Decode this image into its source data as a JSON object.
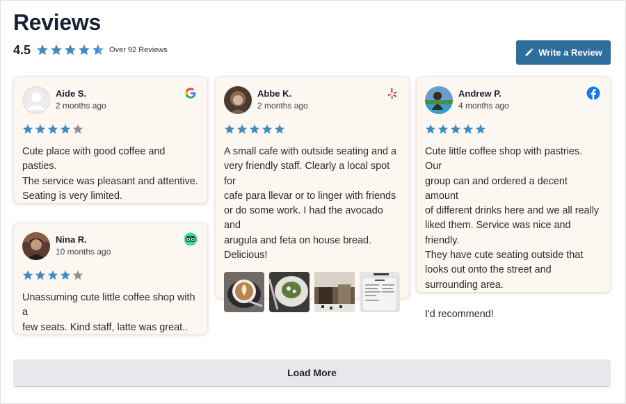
{
  "header": {
    "title": "Reviews",
    "average": "4.5",
    "rating_value": 4.5,
    "count_text": "Over 92 Reviews",
    "write_review_label": "Write a Review"
  },
  "colors": {
    "star_filled": "#3f8bc4",
    "star_empty": "#8f8f8f",
    "button": "#2f6d9d",
    "card_bg": "#fdf7f2"
  },
  "reviews": [
    {
      "name": "Aide S.",
      "time": "2 months ago",
      "source": "google-icon",
      "rating": 4,
      "text": "Cute place with good coffee and pasties.\nThe service was pleasant and attentive.\nSeating is very limited."
    },
    {
      "name": "Nina R.",
      "time": "10 months ago",
      "source": "tripadvisor-icon",
      "rating": 4,
      "text": "Unassuming cute little coffee shop with a\nfew seats. Kind staff, latte was great.."
    },
    {
      "name": "Abbe K.",
      "time": "2 months ago",
      "source": "yelp-icon",
      "rating": 5,
      "text": "A small cafe with outside seating and a\nvery friendly staff. Clearly a local spot for\ncafe para llevar or to linger with friends\nor do some work. I had the avocado and\narugula and feta on house bread.\nDelicious!",
      "photos": [
        "latte-art-photo",
        "salad-plate-photo",
        "cafe-interior-photo",
        "menu-board-photo"
      ]
    },
    {
      "name": "Andrew P.",
      "time": "4 months ago",
      "source": "facebook-icon",
      "rating": 5,
      "text": "Cute little coffee shop with pastries. Our\ngroup can and ordered a decent amount\nof different drinks here and we all really\nliked them. Service was nice and friendly.\nThey have cute seating outside that\nlooks out onto the street and\nsurrounding area.\n\nI'd recommend!"
    }
  ],
  "load_more_label": "Load More"
}
